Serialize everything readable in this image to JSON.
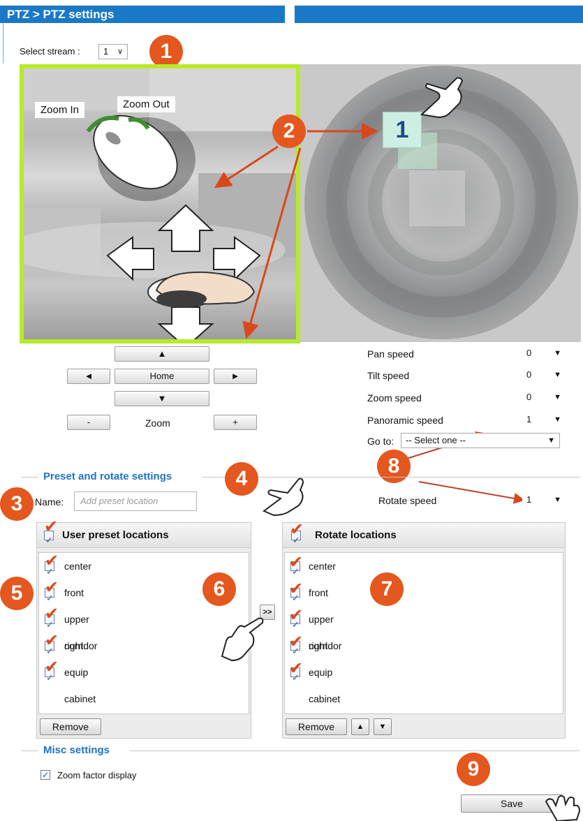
{
  "header": {
    "title": "PTZ > PTZ settings"
  },
  "stream": {
    "label": "Select stream :",
    "value": "1"
  },
  "view": {
    "zoom_in_label": "Zoom In",
    "zoom_out_label": "Zoom Out",
    "preset_chip": "1"
  },
  "controls": {
    "up": "▲",
    "left": "◄",
    "home": "Home",
    "right": "►",
    "down": "▼",
    "zoom_minus": "-",
    "zoom_label": "Zoom",
    "zoom_plus": "+"
  },
  "speeds": {
    "pan_label": "Pan speed",
    "pan_value": "0",
    "tilt_label": "Tilt speed",
    "tilt_value": "0",
    "zoom_label": "Zoom speed",
    "zoom_value": "0",
    "panoramic_label": "Panoramic speed",
    "panoramic_value": "1",
    "goto_label": "Go to:",
    "goto_value": "-- Select one --"
  },
  "preset_section": {
    "legend": "Preset and rotate settings",
    "name_label": "Name:",
    "name_placeholder": "Add preset location",
    "rotate_speed_label": "Rotate speed",
    "rotate_speed_value": "1",
    "user_header": "User preset locations",
    "rotate_header": "Rotate locations",
    "user_items": [
      "center",
      "front",
      "upper right",
      "corridor",
      "equip cabinet"
    ],
    "rotate_items": [
      "center",
      "front",
      "upper right",
      "corridor",
      "equip cabinet"
    ],
    "remove_label": "Remove",
    "transfer_label": ">>",
    "up_label": "▲",
    "down_label": "▼"
  },
  "misc": {
    "legend": "Misc settings",
    "zoom_factor_label": "Zoom factor display",
    "save_label": "Save"
  },
  "badges": [
    "1",
    "2",
    "3",
    "4",
    "5",
    "6",
    "7",
    "8",
    "9"
  ],
  "colors": {
    "header_blue": "#1a79c6",
    "badge_orange": "#e4571e",
    "legend_blue": "#1f74c4",
    "view_border": "#b8ea2a",
    "annotation_red": "#e0471b"
  }
}
